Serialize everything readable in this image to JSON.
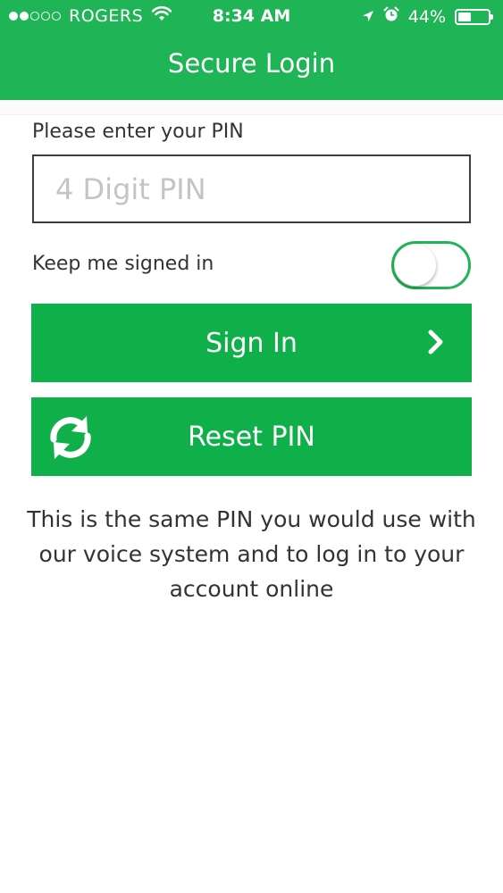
{
  "status_bar": {
    "carrier": "ROGERS",
    "time": "8:34 AM",
    "battery": "44%",
    "battery_level": 0.44,
    "signal_bars_filled": 2,
    "signal_bars_total": 5
  },
  "header": {
    "title": "Secure Login"
  },
  "form": {
    "pin_label": "Please enter your PIN",
    "pin_placeholder": "4 Digit PIN",
    "pin_value": "",
    "keep_signed_in_label": "Keep me signed in",
    "keep_signed_in": false
  },
  "buttons": {
    "sign_in": "Sign In",
    "reset_pin": "Reset PIN"
  },
  "info_text": "This is the same PIN you would use with our voice system and to log in to your account online",
  "colors": {
    "brand_green": "#1fb455",
    "button_green": "#0fb04a"
  },
  "icons": {
    "wifi": "wifi-icon",
    "location": "location-arrow-icon",
    "alarm": "alarm-clock-icon",
    "battery": "battery-icon",
    "chevron": "chevron-right-icon",
    "refresh": "refresh-icon"
  }
}
